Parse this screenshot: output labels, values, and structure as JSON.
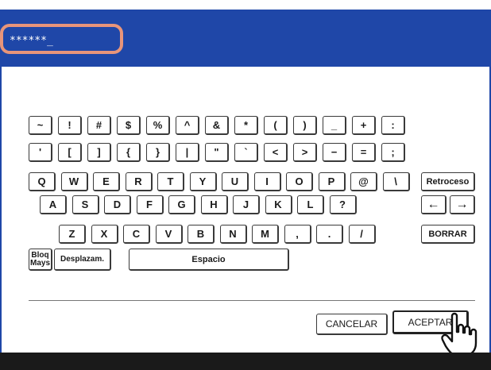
{
  "input": {
    "value": "******_"
  },
  "keys": {
    "row1": [
      "~",
      "!",
      "#",
      "$",
      "%",
      "^",
      "&",
      "*",
      "(",
      ")",
      "_",
      "+",
      ":"
    ],
    "row2": [
      "'",
      "[",
      "]",
      "{",
      "}",
      "|",
      "\"",
      "`",
      "<",
      ">",
      "−",
      "=",
      ";"
    ],
    "row3": [
      "Q",
      "W",
      "E",
      "R",
      "T",
      "Y",
      "U",
      "I",
      "O",
      "P",
      "@",
      "\\"
    ],
    "row4": [
      "A",
      "S",
      "D",
      "F",
      "G",
      "H",
      "J",
      "K",
      "L",
      "?"
    ],
    "row5": [
      "Z",
      "X",
      "C",
      "V",
      "B",
      "N",
      "M",
      ",",
      ".",
      "/"
    ],
    "backspace": "Retroceso",
    "arrow_left": "←",
    "arrow_right": "→",
    "clear": "BORRAR",
    "caps": "Bloq\nMays",
    "shift": "Desplazam.",
    "space": "Espacio"
  },
  "actions": {
    "cancel": "CANCELAR",
    "accept": "ACEPTAR"
  },
  "colors": {
    "header_blue": "#1f47a8",
    "highlight": "#e8957a",
    "bottom_bar": "#1a1a1a"
  },
  "icons": {
    "pointer": "hand-pointer-icon"
  }
}
